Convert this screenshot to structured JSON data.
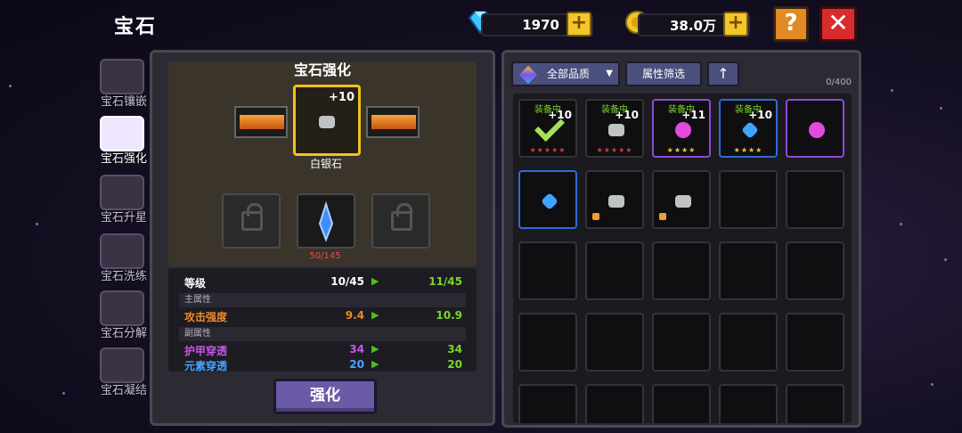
{
  "header": {
    "title": "宝石"
  },
  "resources": [
    {
      "name": "diamond",
      "value": "1970"
    },
    {
      "name": "gold",
      "value": "38.0万"
    }
  ],
  "sidebar": {
    "items": [
      {
        "label": "宝石镶嵌"
      },
      {
        "label": "宝石强化"
      },
      {
        "label": "宝石升星"
      },
      {
        "label": "宝石洗练"
      },
      {
        "label": "宝石分解"
      },
      {
        "label": "宝石凝结"
      }
    ]
  },
  "enhance": {
    "title": "宝石强化",
    "gem_level": "+10",
    "gem_name": "白银石",
    "progress": "50/145",
    "level_label": "等级",
    "level_cur": "10/45",
    "level_next": "11/45",
    "main_attr_header": "主属性",
    "attack_label": "攻击强度",
    "attack_cur": "9.4",
    "attack_next": "10.9",
    "sub_attr_header": "副属性",
    "armor_label": "护甲穿透",
    "armor_cur": "34",
    "armor_next": "34",
    "element_label": "元素穿透",
    "element_cur": "20",
    "element_next": "20",
    "button_label": "强化"
  },
  "inventory": {
    "filter_quality": "全部品质",
    "filter_attr": "属性筛选",
    "count": "0/400",
    "items": [
      {
        "equipped": "装备中",
        "level": "+10",
        "gem": "check",
        "stars": "★★★★★",
        "star_color": "red"
      },
      {
        "equipped": "装备中",
        "level": "+10",
        "gem": "silver",
        "stars": "★★★★★",
        "star_color": "red"
      },
      {
        "equipped": "装备中",
        "level": "+11",
        "gem": "purple",
        "stars": "★★★★",
        "star_color": "gold"
      },
      {
        "equipped": "装备中",
        "level": "+10",
        "gem": "blue",
        "stars": "★★★★",
        "star_color": "gold"
      },
      {
        "equipped": "",
        "level": "",
        "gem": "purple",
        "stars": "",
        "star_color": ""
      },
      {
        "equipped": "",
        "level": "",
        "gem": "blue",
        "stars": "",
        "star_color": ""
      },
      {
        "equipped": "",
        "level": "",
        "gem": "silver",
        "stars": "",
        "star_color": "",
        "locked": true
      },
      {
        "equipped": "",
        "level": "",
        "gem": "silver",
        "stars": "",
        "star_color": "",
        "locked": true
      }
    ]
  }
}
